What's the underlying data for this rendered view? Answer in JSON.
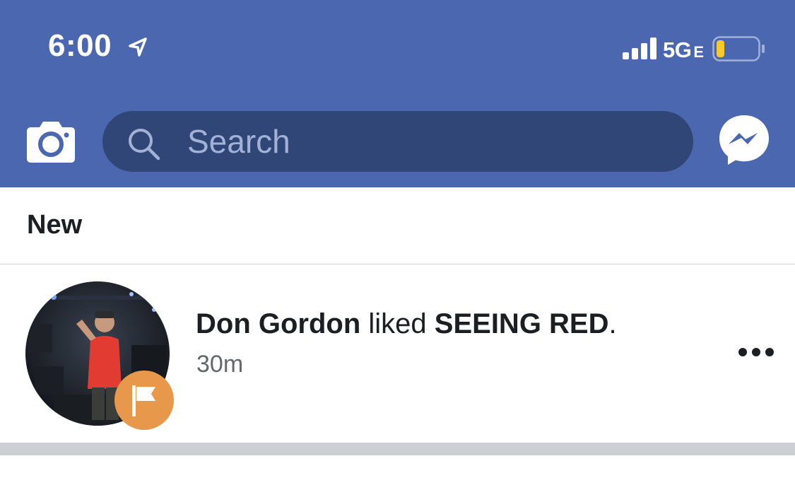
{
  "status_bar": {
    "time": "6:00",
    "network": "5G",
    "network_suffix": "E",
    "battery_level": 0.2
  },
  "header": {
    "search": {
      "placeholder": "Search"
    },
    "icons": [
      "camera-icon",
      "search-icon",
      "messenger-icon"
    ]
  },
  "notifications": {
    "section_label": "New",
    "items": [
      {
        "actor": "Don Gordon",
        "action": " liked ",
        "object": "SEEING RED",
        "punctuation": ".",
        "time": "30m",
        "badge_icon": "flag-icon"
      }
    ]
  },
  "colors": {
    "header_bg": "#4b67b0",
    "search_bg": "#2f4677",
    "badge_orange": "#e8984a"
  }
}
